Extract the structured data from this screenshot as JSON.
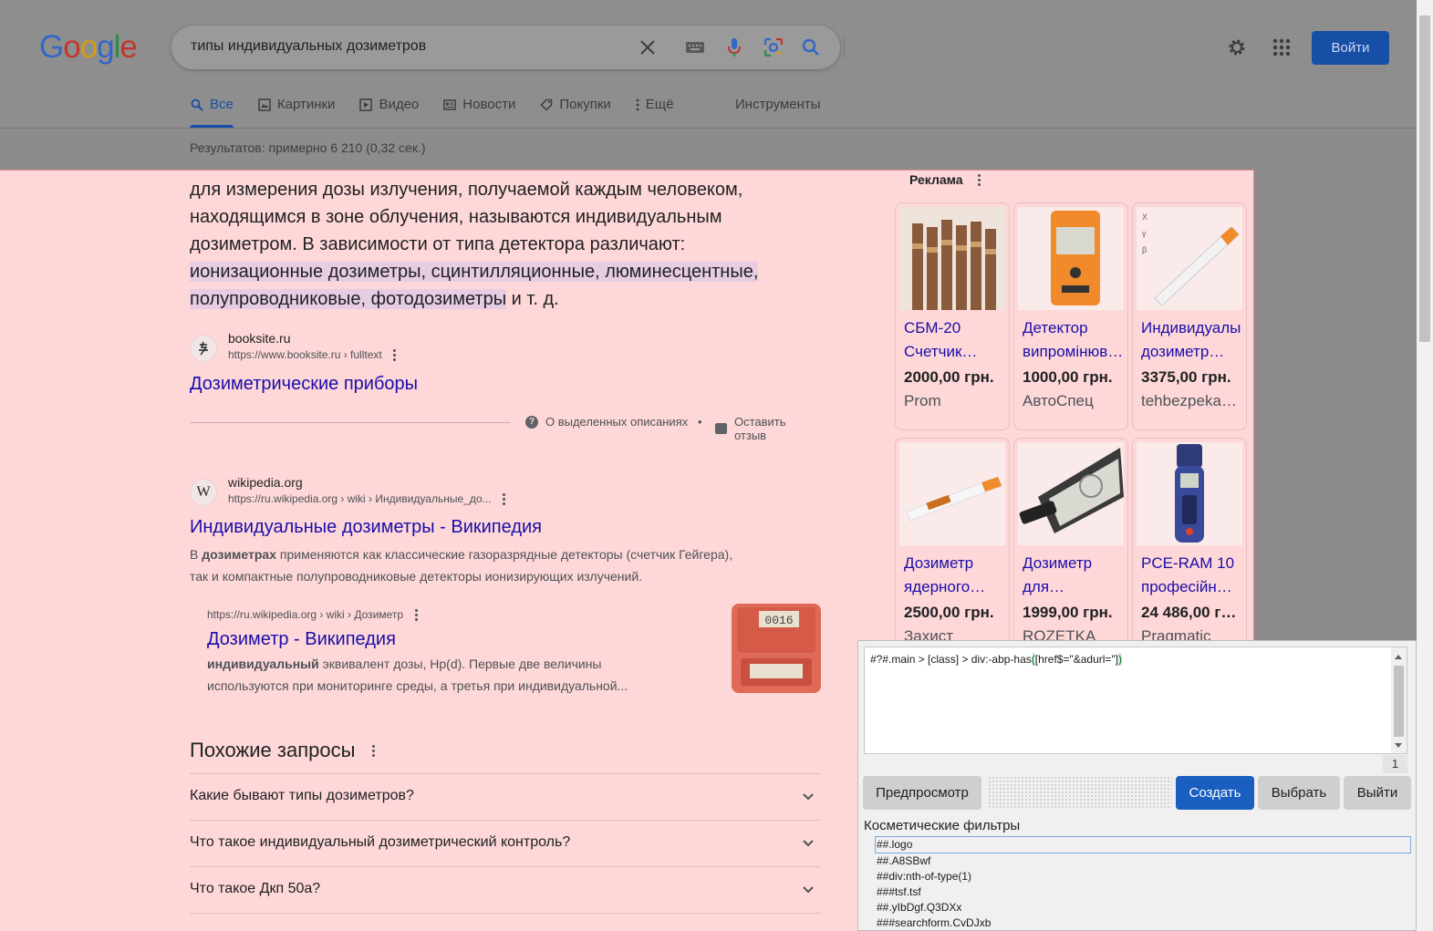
{
  "header": {
    "logo": [
      "G",
      "o",
      "o",
      "g",
      "l",
      "e"
    ],
    "logo_colors": [
      "#3367c6",
      "#c2362a",
      "#d49e0e",
      "#3367c6",
      "#2f8c48",
      "#c2362a"
    ],
    "query": "типы индивидуальных дозиметров",
    "signin_label": "Войти"
  },
  "tabs": [
    {
      "label": "Все",
      "icon": "search-icon",
      "active": true
    },
    {
      "label": "Картинки",
      "icon": "image-icon"
    },
    {
      "label": "Видео",
      "icon": "video-icon"
    },
    {
      "label": "Новости",
      "icon": "news-icon"
    },
    {
      "label": "Покупки",
      "icon": "tag-icon"
    },
    {
      "label": "Ещё",
      "icon": "more-vert-icon"
    }
  ],
  "tools_label": "Инструменты",
  "stats": "Результатов: примерно 6 210 (0,32 сек.)",
  "snippet": {
    "plain": "для измерения дозы излучения, получаемой каждым человеком, находящимся в зоне облучения, называются индивидуальным дозиметром. В зависимости от типа детектора различают: ",
    "highlight": "ионизационные дозиметры, сцинтилляционные, люминесцентные, полупроводниковые, фотодозиметры",
    "tail": " и т. д."
  },
  "result1": {
    "site": "booksite.ru",
    "url": "https://www.booksite.ru › fulltext",
    "title": "Дозиметрические приборы"
  },
  "featured_footer": {
    "about": "О выделенных описаниях",
    "sep": "•",
    "feedback": "Оставить отзыв"
  },
  "result2": {
    "favicon": "W",
    "site": "wikipedia.org",
    "url": "https://ru.wikipedia.org › wiki › Индивидуальные_до...",
    "title": "Индивидуальные дозиметры - Википедия",
    "desc_pre": "В ",
    "desc_bold": "дозиметрах",
    "desc_post": " применяются как классические газоразрядные детекторы (счетчик Гейгера),",
    "desc_line2": "так и компактные полупроводниковые детекторы ионизирующих излучений."
  },
  "subresult": {
    "url": "https://ru.wikipedia.org › wiki › Дозиметр",
    "title": "Дозиметр - Википедия",
    "desc_bold": "индивидуальный",
    "desc_post": " эквивалент дозы, Hp(d). Первые две величины",
    "desc_line2": "используются при мониторинге среды, а третья при индивидуальной...",
    "thumb_text": "0016"
  },
  "related": {
    "title": "Похожие запросы",
    "items": [
      "Какие бывают типы дозиметров?",
      "Что такое индивидуальный дозиметрический контроль?",
      "Что такое Дкп 50а?"
    ]
  },
  "ads": {
    "label": "Реклама",
    "items": [
      {
        "title1": "СБМ-20",
        "title2": "Счетчик…",
        "price": "2000,00 грн.",
        "store": "Prom"
      },
      {
        "title1": "Детектор",
        "title2": "випромінюв…",
        "price": "1000,00 грн.",
        "store": "АвтоСпец"
      },
      {
        "title1": "Индивидуалы",
        "title2": "дозиметр…",
        "price": "3375,00 грн.",
        "store": "tehbezpeka…"
      },
      {
        "title1": "Дозиметр",
        "title2": "ядерного…",
        "price": "2500,00 грн.",
        "store": "Захист"
      },
      {
        "title1": "Дозиметр",
        "title2": "для…",
        "price": "1999,00 грн.",
        "store": "ROZETKA"
      },
      {
        "title1": "PCE-RAM 10",
        "title2": "професійн…",
        "price": "24 486,00 г…",
        "store": "Pragmatic"
      }
    ]
  },
  "filter_dialog": {
    "code_pre": "#?#.main > [class] > div:-abp-has",
    "code_br1": "(",
    "code_mid": "[href$=\"&adurl=\"]",
    "code_br2": ")",
    "line_count": "1",
    "preview": "Предпросмотр",
    "create": "Создать",
    "select": "Выбрать",
    "exit": "Выйти",
    "section": "Косметические фильтры",
    "filters": [
      "##.logo",
      "##.A8SBwf",
      "##div:nth-of-type(1)",
      "###tsf.tsf",
      "##.yIbDgf.Q3DXx",
      "###searchform.CvDJxb"
    ]
  }
}
